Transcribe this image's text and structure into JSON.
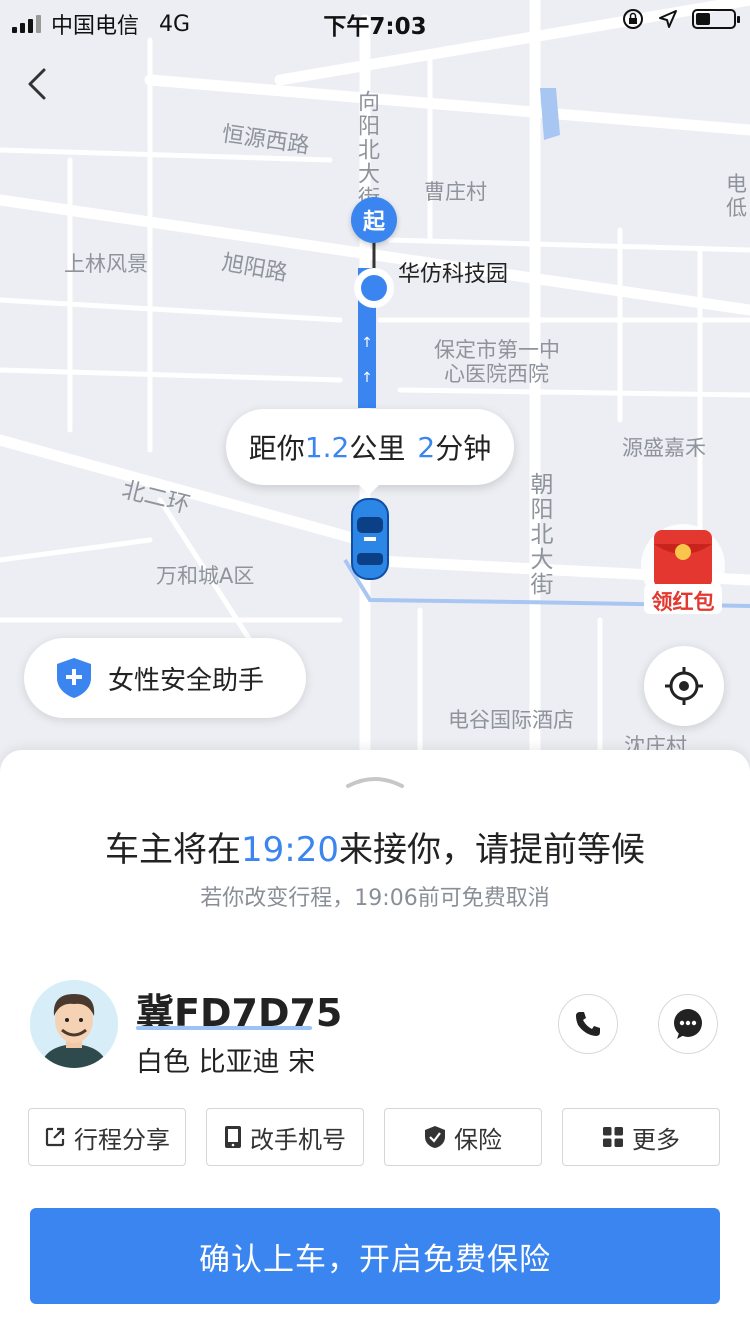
{
  "status_bar": {
    "carrier": "中国电信",
    "network": "4G",
    "time": "下午7:03"
  },
  "map": {
    "roads": {
      "hengyuan_west": "恒源西路",
      "xuyang": "旭阳路",
      "north_second_ring": "北二环",
      "xiangyang_north": "向阳北大街",
      "chaoyang_north": "朝阳北大街"
    },
    "places": {
      "caozhuang": "曹庄村",
      "shanglin": "上林风景",
      "hospital_line1": "保定市第一中",
      "hospital_line2": "心医院西院",
      "yuansheng": "源盛嘉禾",
      "wanhecheng": "万和城A区",
      "diangu_hotel": "电谷国际酒店",
      "shenzhuang": "沈庄村",
      "edge_top_right": "电\n低"
    },
    "start_marker": "起",
    "start_place": "华仿科技园",
    "distance_bubble": {
      "prefix": "距你",
      "distance": "1.2",
      "unit": "公里",
      "minutes": "2",
      "minutes_unit": "分钟"
    },
    "hongbao_label": "领红包",
    "safety_assistant": "女性安全助手",
    "route_color": "#3a85f0"
  },
  "sheet": {
    "pickup_prefix": "车主将在",
    "pickup_time": "19:20",
    "pickup_suffix": "来接你，请提前等候",
    "cancel_note": "若你改变行程，19:06前可免费取消",
    "plate": "冀FD7D75",
    "car_description": "白色 比亚迪 宋",
    "actions": [
      {
        "label": "行程分享",
        "icon": "share-icon"
      },
      {
        "label": "改手机号",
        "icon": "phone-device-icon"
      },
      {
        "label": "保险",
        "icon": "shield-check-icon"
      },
      {
        "label": "更多",
        "icon": "grid-icon"
      }
    ],
    "confirm_label": "确认上车，开启免费保险"
  },
  "colors": {
    "accent": "#3a85f0",
    "hongbao_red": "#e3372f"
  }
}
